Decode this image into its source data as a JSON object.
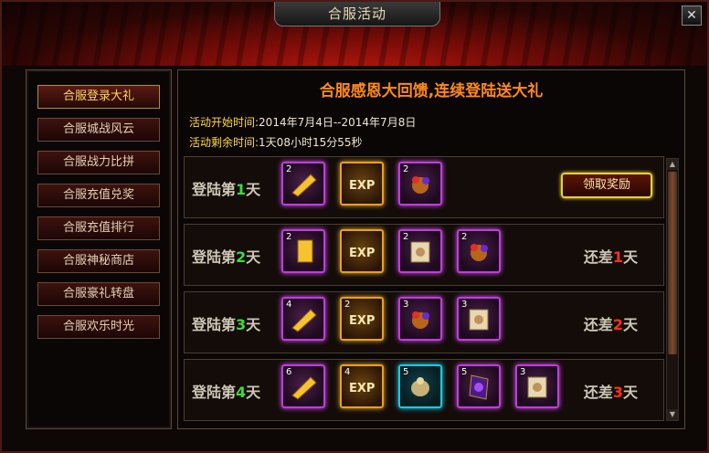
{
  "window": {
    "title": "合服活动",
    "close_label": "✕"
  },
  "sidebar": {
    "items": [
      {
        "label": "合服登录大礼",
        "active": true
      },
      {
        "label": "合服城战风云"
      },
      {
        "label": "合服战力比拼"
      },
      {
        "label": "合服充值兑奖"
      },
      {
        "label": "合服充值排行"
      },
      {
        "label": "合服神秘商店"
      },
      {
        "label": "合服豪礼转盘"
      },
      {
        "label": "合服欢乐时光"
      }
    ]
  },
  "main": {
    "banner": "合服感恩大回馈,连续登陆送大礼",
    "start_label": "活动开始时间:",
    "start_value": "2014年7月4日--2014年7月8日",
    "remain_label": "活动剩余时间:",
    "remain_value": "1天08小时15分55秒",
    "rows": [
      {
        "day_prefix": "登陆第",
        "day_num": "1",
        "day_suffix": "天",
        "items": [
          {
            "count": "2",
            "icon": "gold-bar-icon"
          },
          {
            "count": "",
            "icon": "exp-scroll-icon"
          },
          {
            "count": "2",
            "icon": "treasure-bundle-icon"
          }
        ],
        "action_label": "领取奖励"
      },
      {
        "day_prefix": "登陆第",
        "day_num": "2",
        "day_suffix": "天",
        "items": [
          {
            "count": "2",
            "icon": "gold-bar-icon"
          },
          {
            "count": "",
            "icon": "exp-scroll-icon"
          },
          {
            "count": "2",
            "icon": "scroll-icon"
          },
          {
            "count": "2",
            "icon": "treasure-bundle-icon"
          }
        ],
        "status_prefix": "还差",
        "status_num": "1",
        "status_suffix": "天"
      },
      {
        "day_prefix": "登陆第",
        "day_num": "3",
        "day_suffix": "天",
        "items": [
          {
            "count": "4",
            "icon": "gold-bar-icon"
          },
          {
            "count": "2",
            "icon": "exp-scroll-icon"
          },
          {
            "count": "3",
            "icon": "treasure-bundle-icon"
          },
          {
            "count": "3",
            "icon": "scroll-icon"
          }
        ],
        "status_prefix": "还差",
        "status_num": "2",
        "status_suffix": "天"
      },
      {
        "day_prefix": "登陆第",
        "day_num": "4",
        "day_suffix": "天",
        "items": [
          {
            "count": "6",
            "icon": "gold-bar-icon"
          },
          {
            "count": "4",
            "icon": "exp-scroll-icon"
          },
          {
            "count": "5",
            "icon": "ore-pouch-icon"
          },
          {
            "count": "5",
            "icon": "gem-book-icon"
          },
          {
            "count": "3",
            "icon": "scroll-icon"
          }
        ],
        "status_prefix": "还差",
        "status_num": "3",
        "status_suffix": "天"
      }
    ]
  },
  "colors": {
    "accent": "#ff8a1a",
    "highlight": "#ffd84a",
    "day_green": "#3ddc3d",
    "days_left_red": "#ff3020"
  }
}
